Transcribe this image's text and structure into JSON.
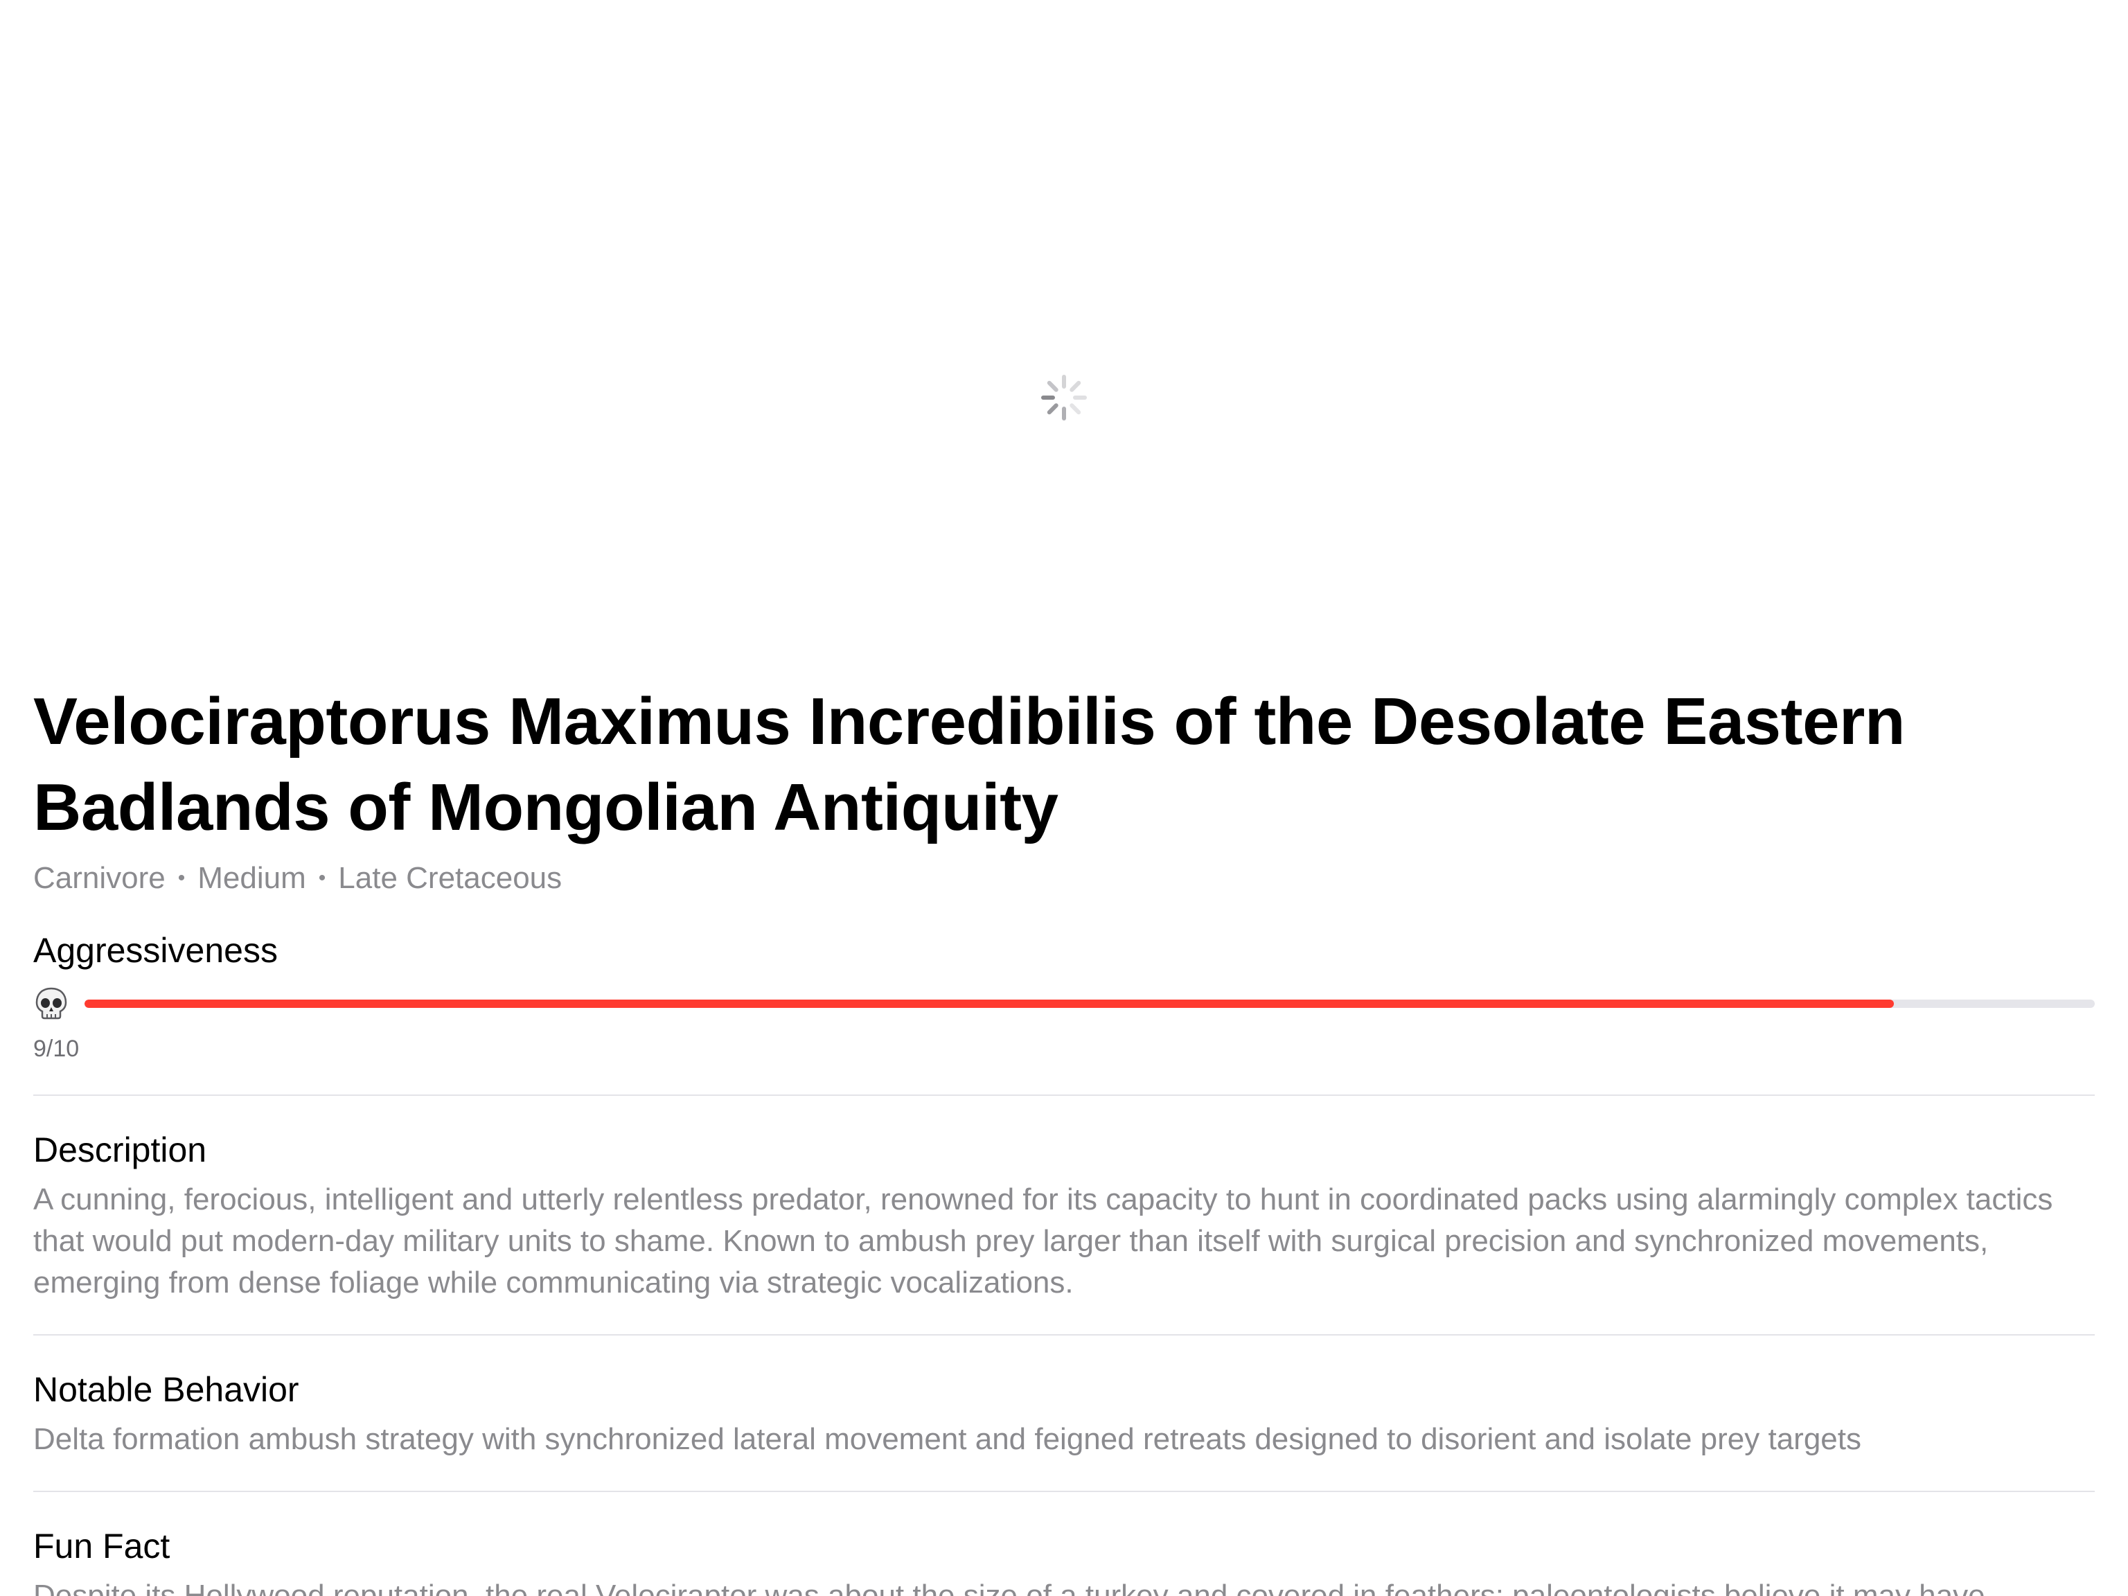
{
  "loading": {
    "spinner_icon": "activity-spinner-icon"
  },
  "dino": {
    "name": "Velociraptorus Maximus Incredibilis of the Desolate Eastern Badlands of Mongolian Antiquity",
    "diet": "Carnivore",
    "size": "Medium",
    "period": "Late Cretaceous",
    "separator": "•"
  },
  "aggressiveness": {
    "label": "Aggressiveness",
    "icon": "skull-icon",
    "value": 9,
    "max": 10,
    "score_text": "9/10",
    "bar_color": "#ff3b30",
    "track_color": "#e5e5ea"
  },
  "description": {
    "label": "Description",
    "text": "A cunning, ferocious, intelligent and utterly relentless predator, renowned for its capacity to hunt in coordinated packs using alarmingly complex tactics that would put modern-day military units to shame. Known to ambush prey larger than itself with surgical precision and synchronized movements, emerging from dense foliage while communicating via strategic vocalizations."
  },
  "notable_behavior": {
    "label": "Notable Behavior",
    "text": "Delta formation ambush strategy with synchronized lateral movement and feigned retreats designed to disorient and isolate prey targets"
  },
  "fun_fact": {
    "label": "Fun Fact",
    "text": "Despite its Hollywood reputation, the real Velociraptor was about the size of a turkey and covered in feathers; paleontologists believe it may have"
  }
}
